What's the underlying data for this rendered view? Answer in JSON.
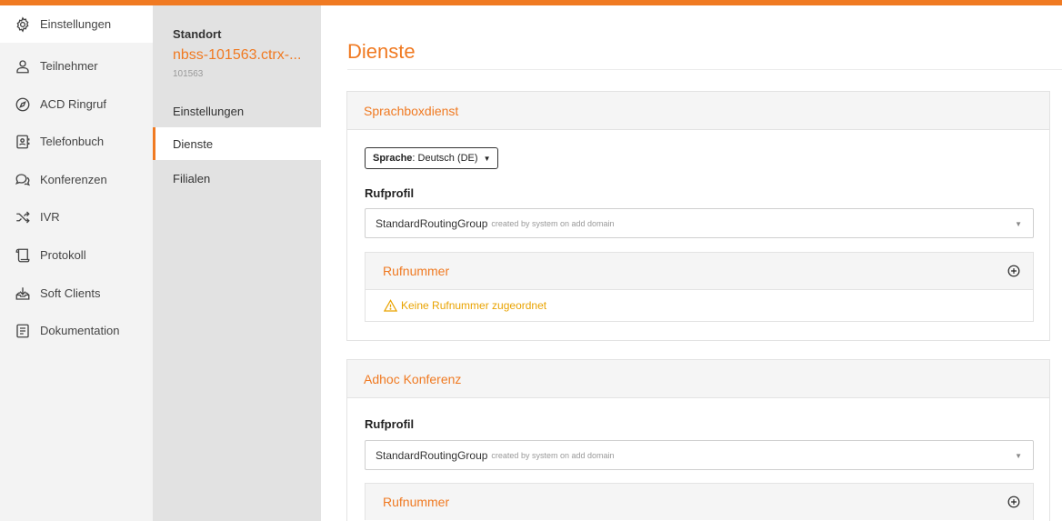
{
  "colors": {
    "accent": "#f07a22",
    "warning": "#e9a300"
  },
  "nav": {
    "items": [
      {
        "label": "Einstellungen",
        "icon": "gear-icon"
      },
      {
        "label": "Teilnehmer",
        "icon": "user-icon"
      },
      {
        "label": "ACD Ringruf",
        "icon": "compass-icon"
      },
      {
        "label": "Telefonbuch",
        "icon": "contact-book-icon"
      },
      {
        "label": "Konferenzen",
        "icon": "chat-bubbles-icon"
      },
      {
        "label": "IVR",
        "icon": "shuffle-icon"
      },
      {
        "label": "Protokoll",
        "icon": "scroll-icon"
      },
      {
        "label": "Soft Clients",
        "icon": "download-tray-icon"
      },
      {
        "label": "Dokumentation",
        "icon": "document-icon"
      }
    ],
    "active": "Einstellungen"
  },
  "location": {
    "label": "Standort",
    "name": "nbss-101563.ctrx-...",
    "id": "101563",
    "menu": [
      {
        "label": "Einstellungen"
      },
      {
        "label": "Dienste"
      },
      {
        "label": "Filialen"
      }
    ],
    "active": "Dienste"
  },
  "main": {
    "title": "Dienste",
    "sprachbox": {
      "title": "Sprachboxdienst",
      "language_key": "Sprache",
      "language_value": ": Deutsch (DE)",
      "rufprofil_label": "Rufprofil",
      "rufprofil_value": "StandardRoutingGroup",
      "rufprofil_meta": "created by system on add domain",
      "rufnummer_title": "Rufnummer",
      "rufnummer_warning": "Keine Rufnummer zugeordnet"
    },
    "adhoc": {
      "title": "Adhoc Konferenz",
      "rufprofil_label": "Rufprofil",
      "rufprofil_value": "StandardRoutingGroup",
      "rufprofil_meta": "created by system on add domain",
      "rufnummer_title": "Rufnummer"
    }
  }
}
